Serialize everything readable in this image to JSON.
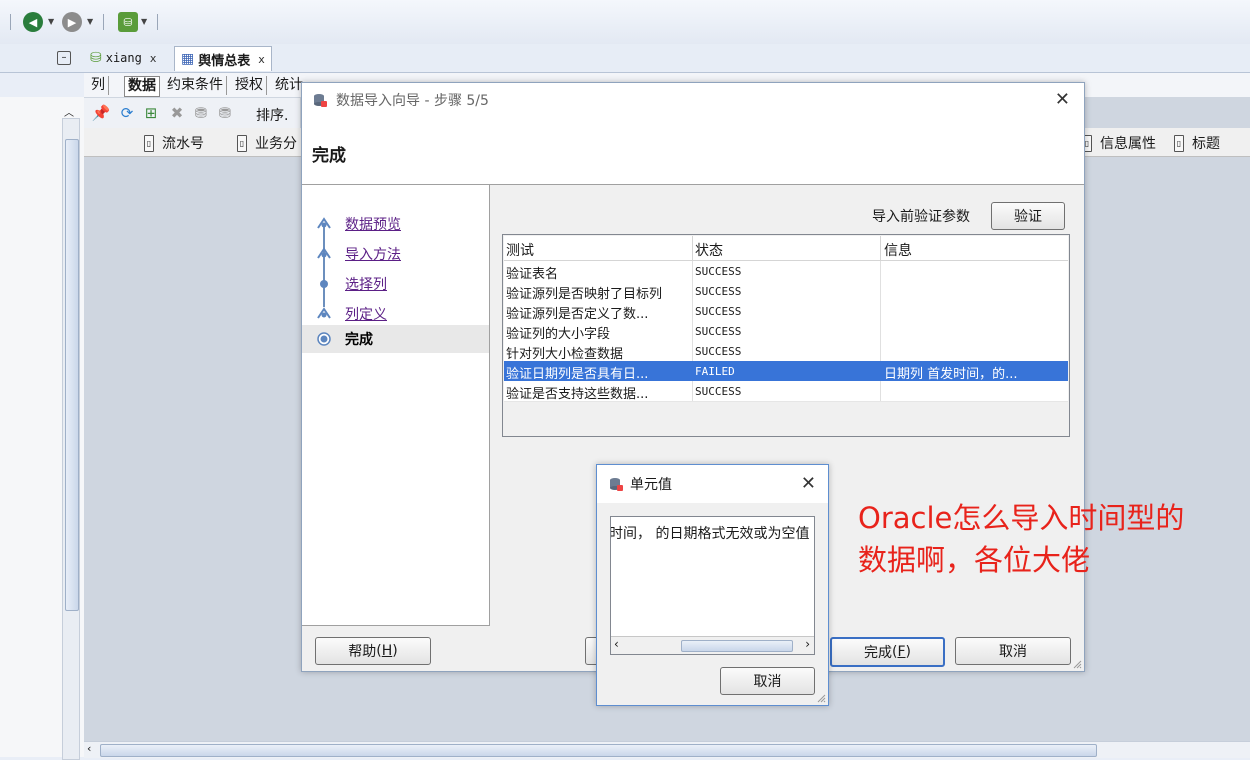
{
  "tabs": [
    {
      "label": "xiang"
    },
    {
      "label": "舆情总表"
    }
  ],
  "subtabs": [
    "列",
    "数据",
    "约束条件",
    "授权",
    "统计"
  ],
  "grid_toolbar": {
    "sort_label": "排序."
  },
  "grid_columns": [
    "流水号",
    "业务分",
    "信息属性",
    "标题"
  ],
  "wizard": {
    "title": "数据导入向导 - 步骤 5/5",
    "header": "完成",
    "steps": [
      "数据预览",
      "导入方法",
      "选择列",
      "列定义",
      "完成"
    ],
    "verify_label": "导入前验证参数",
    "verify_button": "验证",
    "table": {
      "columns": [
        "测试",
        "状态",
        "信息"
      ],
      "rows": [
        {
          "test": "验证表名",
          "status": "SUCCESS",
          "info": ""
        },
        {
          "test": "验证源列是否映射了目标列",
          "status": "SUCCESS",
          "info": ""
        },
        {
          "test": "验证源列是否定义了数...",
          "status": "SUCCESS",
          "info": ""
        },
        {
          "test": "验证列的大小字段",
          "status": "SUCCESS",
          "info": ""
        },
        {
          "test": "针对列大小检查数据",
          "status": "SUCCESS",
          "info": ""
        },
        {
          "test": "验证日期列是否具有日...",
          "status": "FAILED",
          "info": "日期列 首发时间，的..."
        },
        {
          "test": "验证是否支持这些数据...",
          "status": "SUCCESS",
          "info": ""
        }
      ]
    },
    "buttons": {
      "help": "帮助",
      "help_key": "H",
      "finish": "完成",
      "finish_key": "F",
      "cancel": "取消"
    }
  },
  "cell_popup": {
    "title": "单元值",
    "value": "时间， 的日期格式无效或为空值",
    "cancel": "取消"
  },
  "annotation": {
    "line1": "Oracle怎么导入时间型的",
    "line2": "数据啊，各位大佬"
  },
  "colors": {
    "selection": "#3874d8",
    "annotation": "#e8231b",
    "link": "#5b1f86"
  }
}
